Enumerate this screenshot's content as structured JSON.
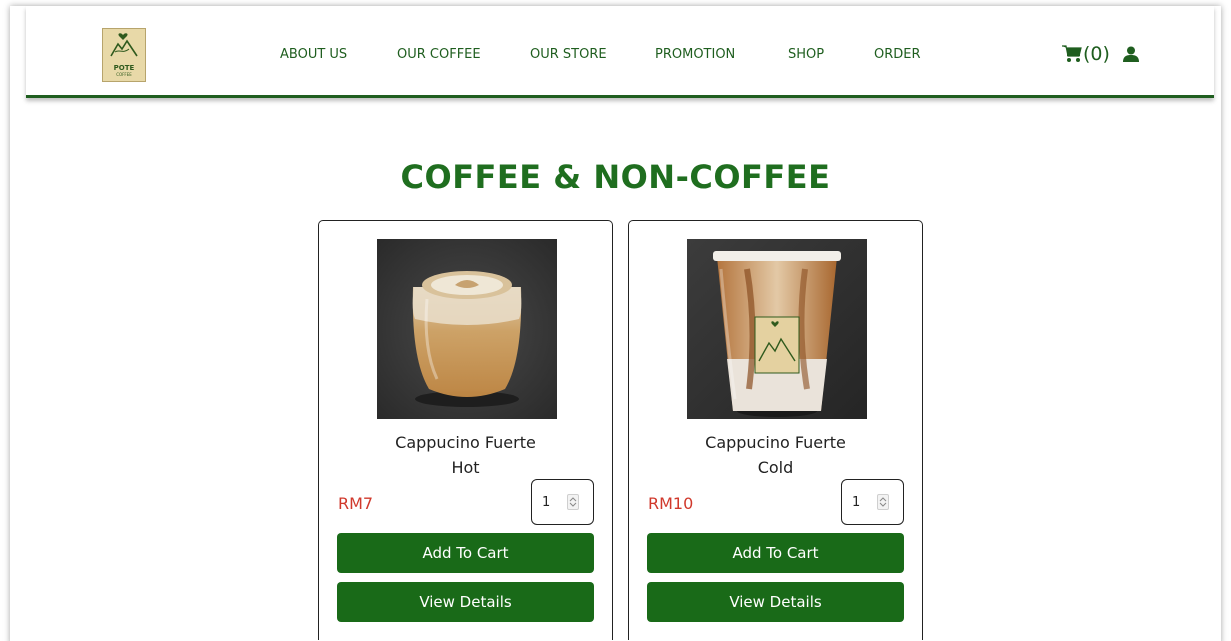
{
  "brand": {
    "logo_text": "POTE",
    "logo_sub": "COFFEE"
  },
  "nav": {
    "items": [
      {
        "label": "ABOUT US"
      },
      {
        "label": "OUR COFFEE"
      },
      {
        "label": "OUR STORE"
      },
      {
        "label": "PROMOTION"
      },
      {
        "label": "SHOP"
      },
      {
        "label": "ORDER"
      }
    ],
    "cart_count": "(0)",
    "cart_icon": "shopping-cart-icon",
    "user_icon": "user-icon"
  },
  "page_title": "COFFEE & NON-COFFEE",
  "products": [
    {
      "name_line1": "Cappucino Fuerte",
      "name_line2": "Hot",
      "price": "RM7",
      "quantity": "1",
      "add_label": "Add To Cart",
      "details_label": "View Details"
    },
    {
      "name_line1": "Cappucino Fuerte",
      "name_line2": "Cold",
      "price": "RM10",
      "quantity": "1",
      "add_label": "Add To Cart",
      "details_label": "View Details"
    }
  ],
  "colors": {
    "brand_green": "#1f5e1f",
    "button_green": "#196a18",
    "price_red": "#d0382b"
  }
}
